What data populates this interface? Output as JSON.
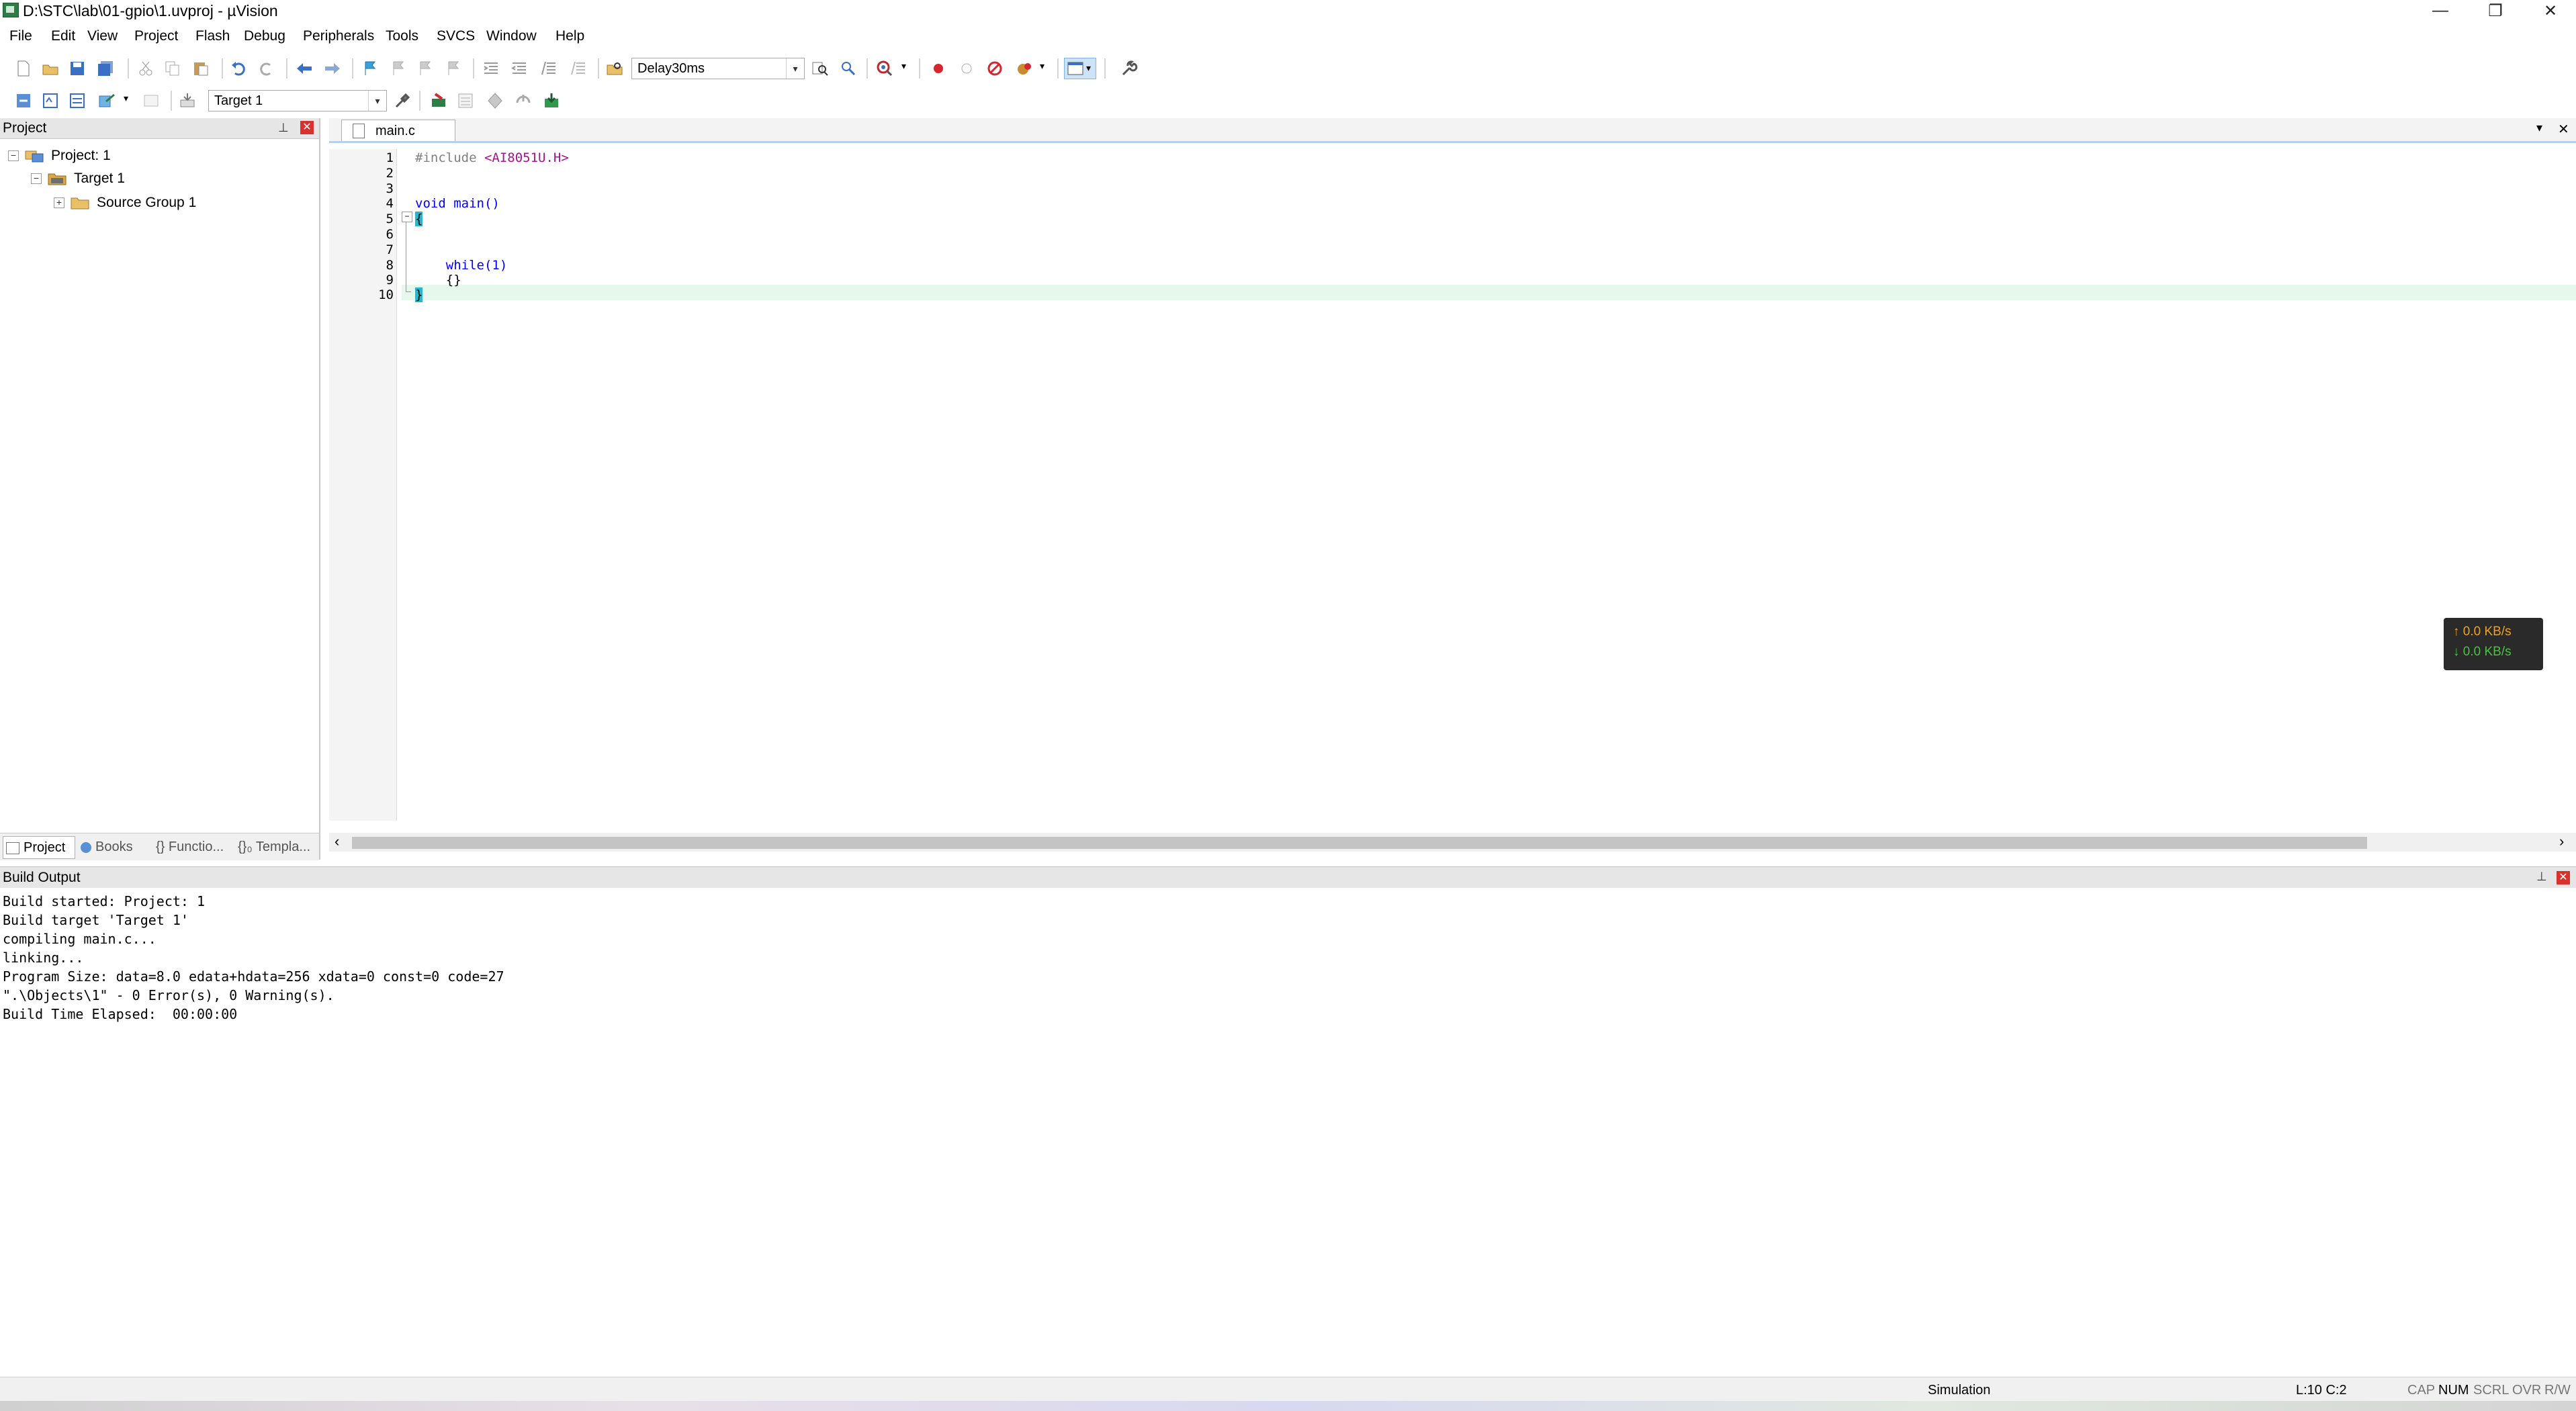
{
  "window": {
    "title": "D:\\STC\\lab\\01-gpio\\1.uvproj - µVision",
    "min_glyph": "—",
    "restore_glyph": "❐",
    "close_glyph": "✕"
  },
  "menu": [
    "File",
    "Edit",
    "View",
    "Project",
    "Flash",
    "Debug",
    "Peripherals",
    "Tools",
    "SVCS",
    "Window",
    "Help"
  ],
  "toolbar": {
    "function_combo": "Delay30ms",
    "target_combo": "Target 1",
    "combo_arrow": "▾"
  },
  "project_panel": {
    "title": "Project",
    "pin_glyph": "⊥",
    "close_glyph": "✕",
    "tree": [
      {
        "label": "Project: 1",
        "expander": "−"
      },
      {
        "label": "Target 1",
        "expander": "−"
      },
      {
        "label": "Source Group 1",
        "expander": "+"
      }
    ],
    "tabs": [
      "Project",
      "Books",
      "{} Functio...",
      "{}₀ Templa..."
    ]
  },
  "editor": {
    "tab_label": "main.c",
    "menu_arrow": "▾",
    "close_glyph": "✕",
    "lines": [
      {
        "num": "1",
        "code": "#include <AI8051U.H>"
      },
      {
        "num": "2",
        "code": ""
      },
      {
        "num": "3",
        "code": ""
      },
      {
        "num": "4",
        "code": "void main()"
      },
      {
        "num": "5",
        "code": "{"
      },
      {
        "num": "6",
        "code": ""
      },
      {
        "num": "7",
        "code": ""
      },
      {
        "num": "8",
        "code": "    while(1)"
      },
      {
        "num": "9",
        "code": "    {}"
      },
      {
        "num": "10",
        "code": "}"
      }
    ],
    "fold_glyph": "−",
    "scroll_left": "‹",
    "scroll_right": "›"
  },
  "net_monitor": {
    "up": "↑ 0.0 KB/s",
    "down": "↓ 0.0 KB/s"
  },
  "build_output": {
    "title": "Build Output",
    "pin_glyph": "⊥",
    "close_glyph": "✕",
    "lines": [
      "Build started: Project: 1",
      "Build target 'Target 1'",
      "compiling main.c...",
      "linking...",
      "Program Size: data=8.0 edata+hdata=256 xdata=0 const=0 code=27",
      "\".\\Objects\\1\" - 0 Error(s), 0 Warning(s).",
      "Build Time Elapsed:  00:00:00"
    ]
  },
  "status": {
    "mode": "Simulation",
    "position": "L:10 C:2",
    "cap": "CAP",
    "num": "NUM",
    "scrl": "SCRL",
    "ovr": "OVR",
    "rw": "R/W"
  },
  "colors": {
    "preprocessor": "#808080",
    "include_path": "#a3158a",
    "keyword": "#0000ff",
    "brace": "#000000",
    "up_speed": "#f0a020",
    "down_speed": "#46c43e"
  }
}
